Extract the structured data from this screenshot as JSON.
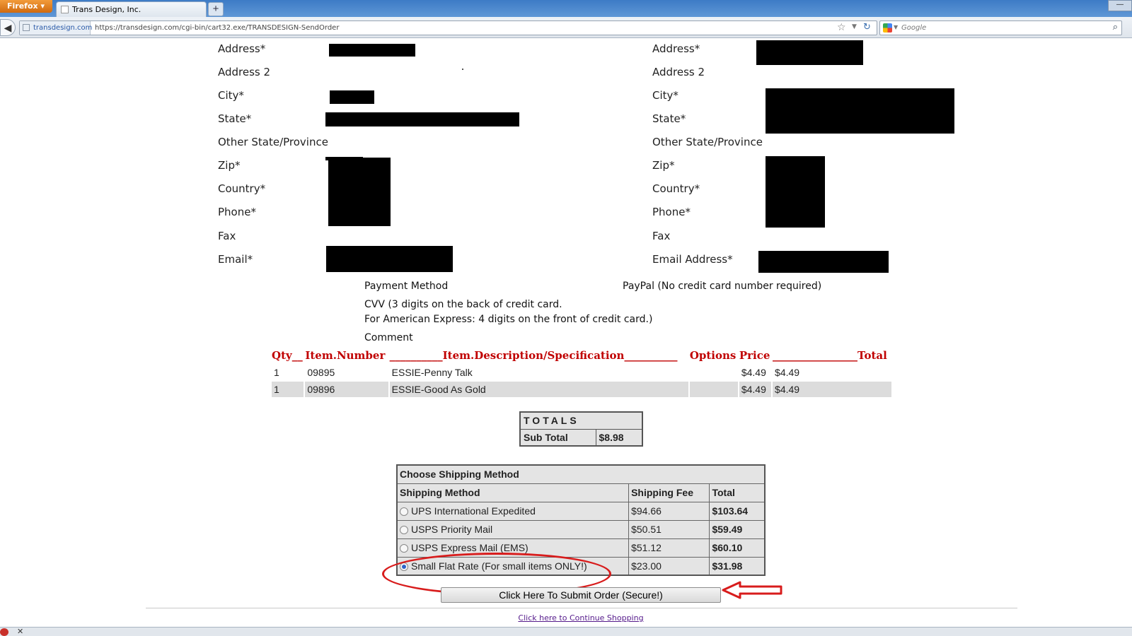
{
  "browser": {
    "menu_button": "Firefox",
    "tab_title": "Trans Design, Inc.",
    "new_tab": "+",
    "back": "◀",
    "site_identity": "transdesign.com",
    "url": "https://transdesign.com/cgi-bin/cart32.exe/TRANSDESIGN-SendOrder",
    "search_placeholder": "Google",
    "star": "☆",
    "dropdown": "▼",
    "reload": "↻",
    "search_go": "⌕",
    "minimize": "—",
    "status_close": "✕"
  },
  "billing": {
    "address": "Address*",
    "address2": "Address 2",
    "city": "City*",
    "state": "State*",
    "other_state": "Other State/Province",
    "zip": "Zip*",
    "country": "Country*",
    "phone": "Phone*",
    "fax": "Fax",
    "email": "Email*"
  },
  "shipping_address": {
    "address": "Address*",
    "address2": "Address 2",
    "city": "City*",
    "state": "State*",
    "other_state": "Other State/Province",
    "zip": "Zip*",
    "country": "Country*",
    "phone": "Phone*",
    "fax": "Fax",
    "email": "Email Address*"
  },
  "payment": {
    "label": "Payment Method",
    "value": "PayPal (No credit card number required)",
    "cvv_line1": "CVV (3 digits on the back of credit card.",
    "cvv_line2": "For American Express: 4 digits on the front of credit card.)",
    "comment": "Comment"
  },
  "items": {
    "headers": {
      "qty": "Qty__",
      "number": "Item.Number",
      "description": "__________Item.Description/Specification__________",
      "options": "Options",
      "price": "Price",
      "total": "________________Total"
    },
    "rows": [
      {
        "qty": "1",
        "number": "09895",
        "description": "ESSIE-Penny Talk",
        "options": "",
        "price": "$4.49",
        "total": "$4.49"
      },
      {
        "qty": "1",
        "number": "09896",
        "description": "ESSIE-Good As Gold",
        "options": "",
        "price": "$4.49",
        "total": "$4.49"
      }
    ]
  },
  "totals": {
    "title": "TOTALS",
    "subtotal_label": "Sub Total",
    "subtotal_value": "$8.98"
  },
  "shipping": {
    "title": "Choose Shipping Method",
    "col_method": "Shipping Method",
    "col_fee": "Shipping Fee",
    "col_total": "Total",
    "options": [
      {
        "name": "UPS International Expedited",
        "fee": "$94.66",
        "total": "$103.64",
        "selected": false
      },
      {
        "name": "USPS Priority Mail",
        "fee": "$50.51",
        "total": "$59.49",
        "selected": false
      },
      {
        "name": "USPS Express Mail (EMS)",
        "fee": "$51.12",
        "total": "$60.10",
        "selected": false
      },
      {
        "name": "Small Flat Rate (For small items ONLY!)",
        "fee": "$23.00",
        "total": "$31.98",
        "selected": true
      }
    ]
  },
  "submit_label": "Click Here To Submit Order (Secure!)",
  "continue_link": "Click here to Continue Shopping",
  "colors": {
    "header_red": "#c00000",
    "annotation_red": "#d81c1c",
    "link": "#551a8b"
  }
}
